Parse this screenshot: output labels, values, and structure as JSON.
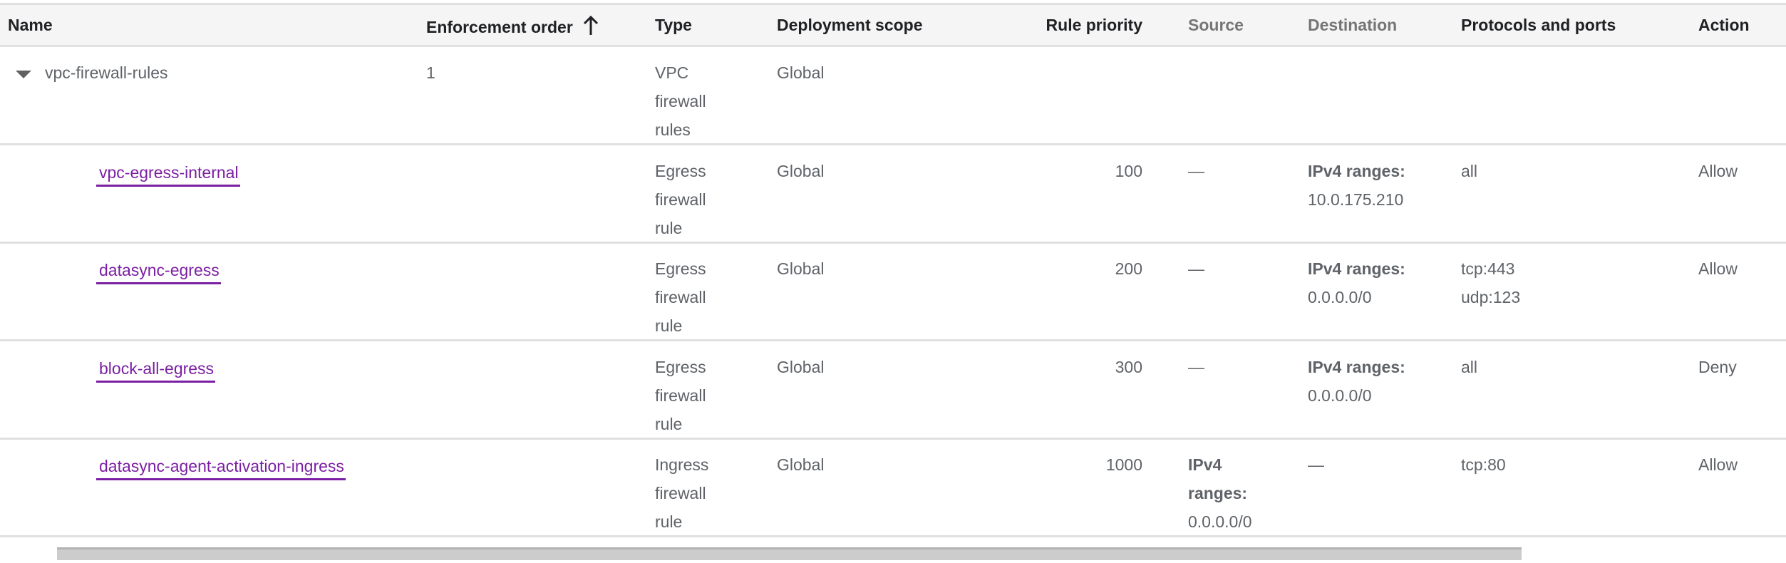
{
  "columns": {
    "name": "Name",
    "enforcement_order": "Enforcement order",
    "type": "Type",
    "deployment_scope": "Deployment scope",
    "rule_priority": "Rule priority",
    "source": "Source",
    "destination": "Destination",
    "protocols_ports": "Protocols and ports",
    "action": "Action"
  },
  "group": {
    "name": "vpc-firewall-rules",
    "enforcement_order": "1",
    "type": [
      "VPC",
      "firewall",
      "rules"
    ],
    "deployment_scope": "Global"
  },
  "rules": [
    {
      "name": "vpc-egress-internal",
      "type": [
        "Egress",
        "firewall",
        "rule"
      ],
      "scope": "Global",
      "priority": "100",
      "source": [
        "—"
      ],
      "source_bold": "",
      "destination_label": "IPv4 ranges:",
      "destination": "10.0.175.210",
      "protocols": [
        "all"
      ],
      "action": "Allow"
    },
    {
      "name": "datasync-egress",
      "type": [
        "Egress",
        "firewall",
        "rule"
      ],
      "scope": "Global",
      "priority": "200",
      "source": [
        "—"
      ],
      "source_bold": "",
      "destination_label": "IPv4 ranges:",
      "destination": "0.0.0.0/0",
      "protocols": [
        "tcp:443",
        "udp:123"
      ],
      "action": "Allow"
    },
    {
      "name": "block-all-egress",
      "type": [
        "Egress",
        "firewall",
        "rule"
      ],
      "scope": "Global",
      "priority": "300",
      "source": [
        "—"
      ],
      "source_bold": "",
      "destination_label": "IPv4 ranges:",
      "destination": "0.0.0.0/0",
      "protocols": [
        "all"
      ],
      "action": "Deny"
    },
    {
      "name": "datasync-agent-activation-ingress",
      "type": [
        "Ingress",
        "firewall",
        "rule"
      ],
      "scope": "Global",
      "priority": "1000",
      "source_bold": [
        "IPv4",
        "ranges:"
      ],
      "source": [
        "0.0.0.0/0"
      ],
      "destination_label": "",
      "destination": "—",
      "protocols": [
        "tcp:80"
      ],
      "action": "Allow"
    }
  ]
}
